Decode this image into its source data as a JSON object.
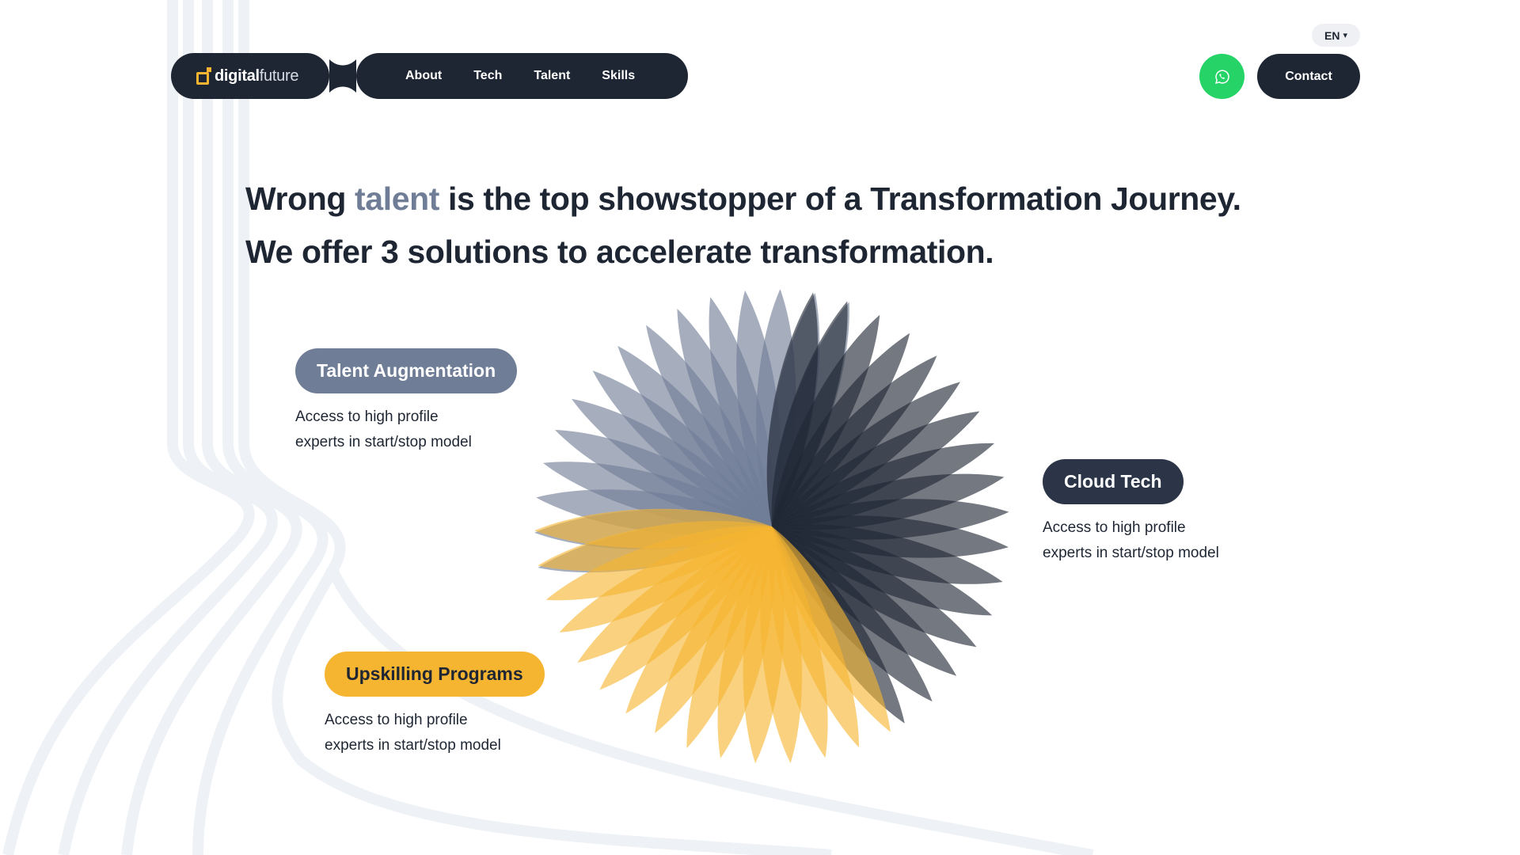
{
  "header": {
    "logo": {
      "bold": "digital",
      "light": "future"
    },
    "nav": [
      "About",
      "Tech",
      "Talent",
      "Skills"
    ],
    "language": "EN",
    "contact_label": "Contact",
    "whatsapp_icon": "whatsapp-icon"
  },
  "hero": {
    "line1_pre": "Wrong ",
    "line1_accent": "talent",
    "line1_post": " is the top showstopper of a Transformation Journey.",
    "line2": "We offer 3 solutions to accelerate transformation."
  },
  "solutions": {
    "talent": {
      "title": "Talent Augmentation",
      "desc1": "Access to high profile",
      "desc2": "experts in start/stop model"
    },
    "cloud": {
      "title": "Cloud Tech",
      "desc1": "Access to high profile",
      "desc2": "experts in start/stop model"
    },
    "upskill": {
      "title": "Upskilling Programs",
      "desc1": "Access to high profile",
      "desc2": "experts in start/stop model"
    }
  },
  "colors": {
    "navy": "#1e2633",
    "slate": "#6f7d96",
    "yellow": "#f6b531",
    "whatsapp": "#25d366",
    "bg_lines": "#eef1f5"
  }
}
